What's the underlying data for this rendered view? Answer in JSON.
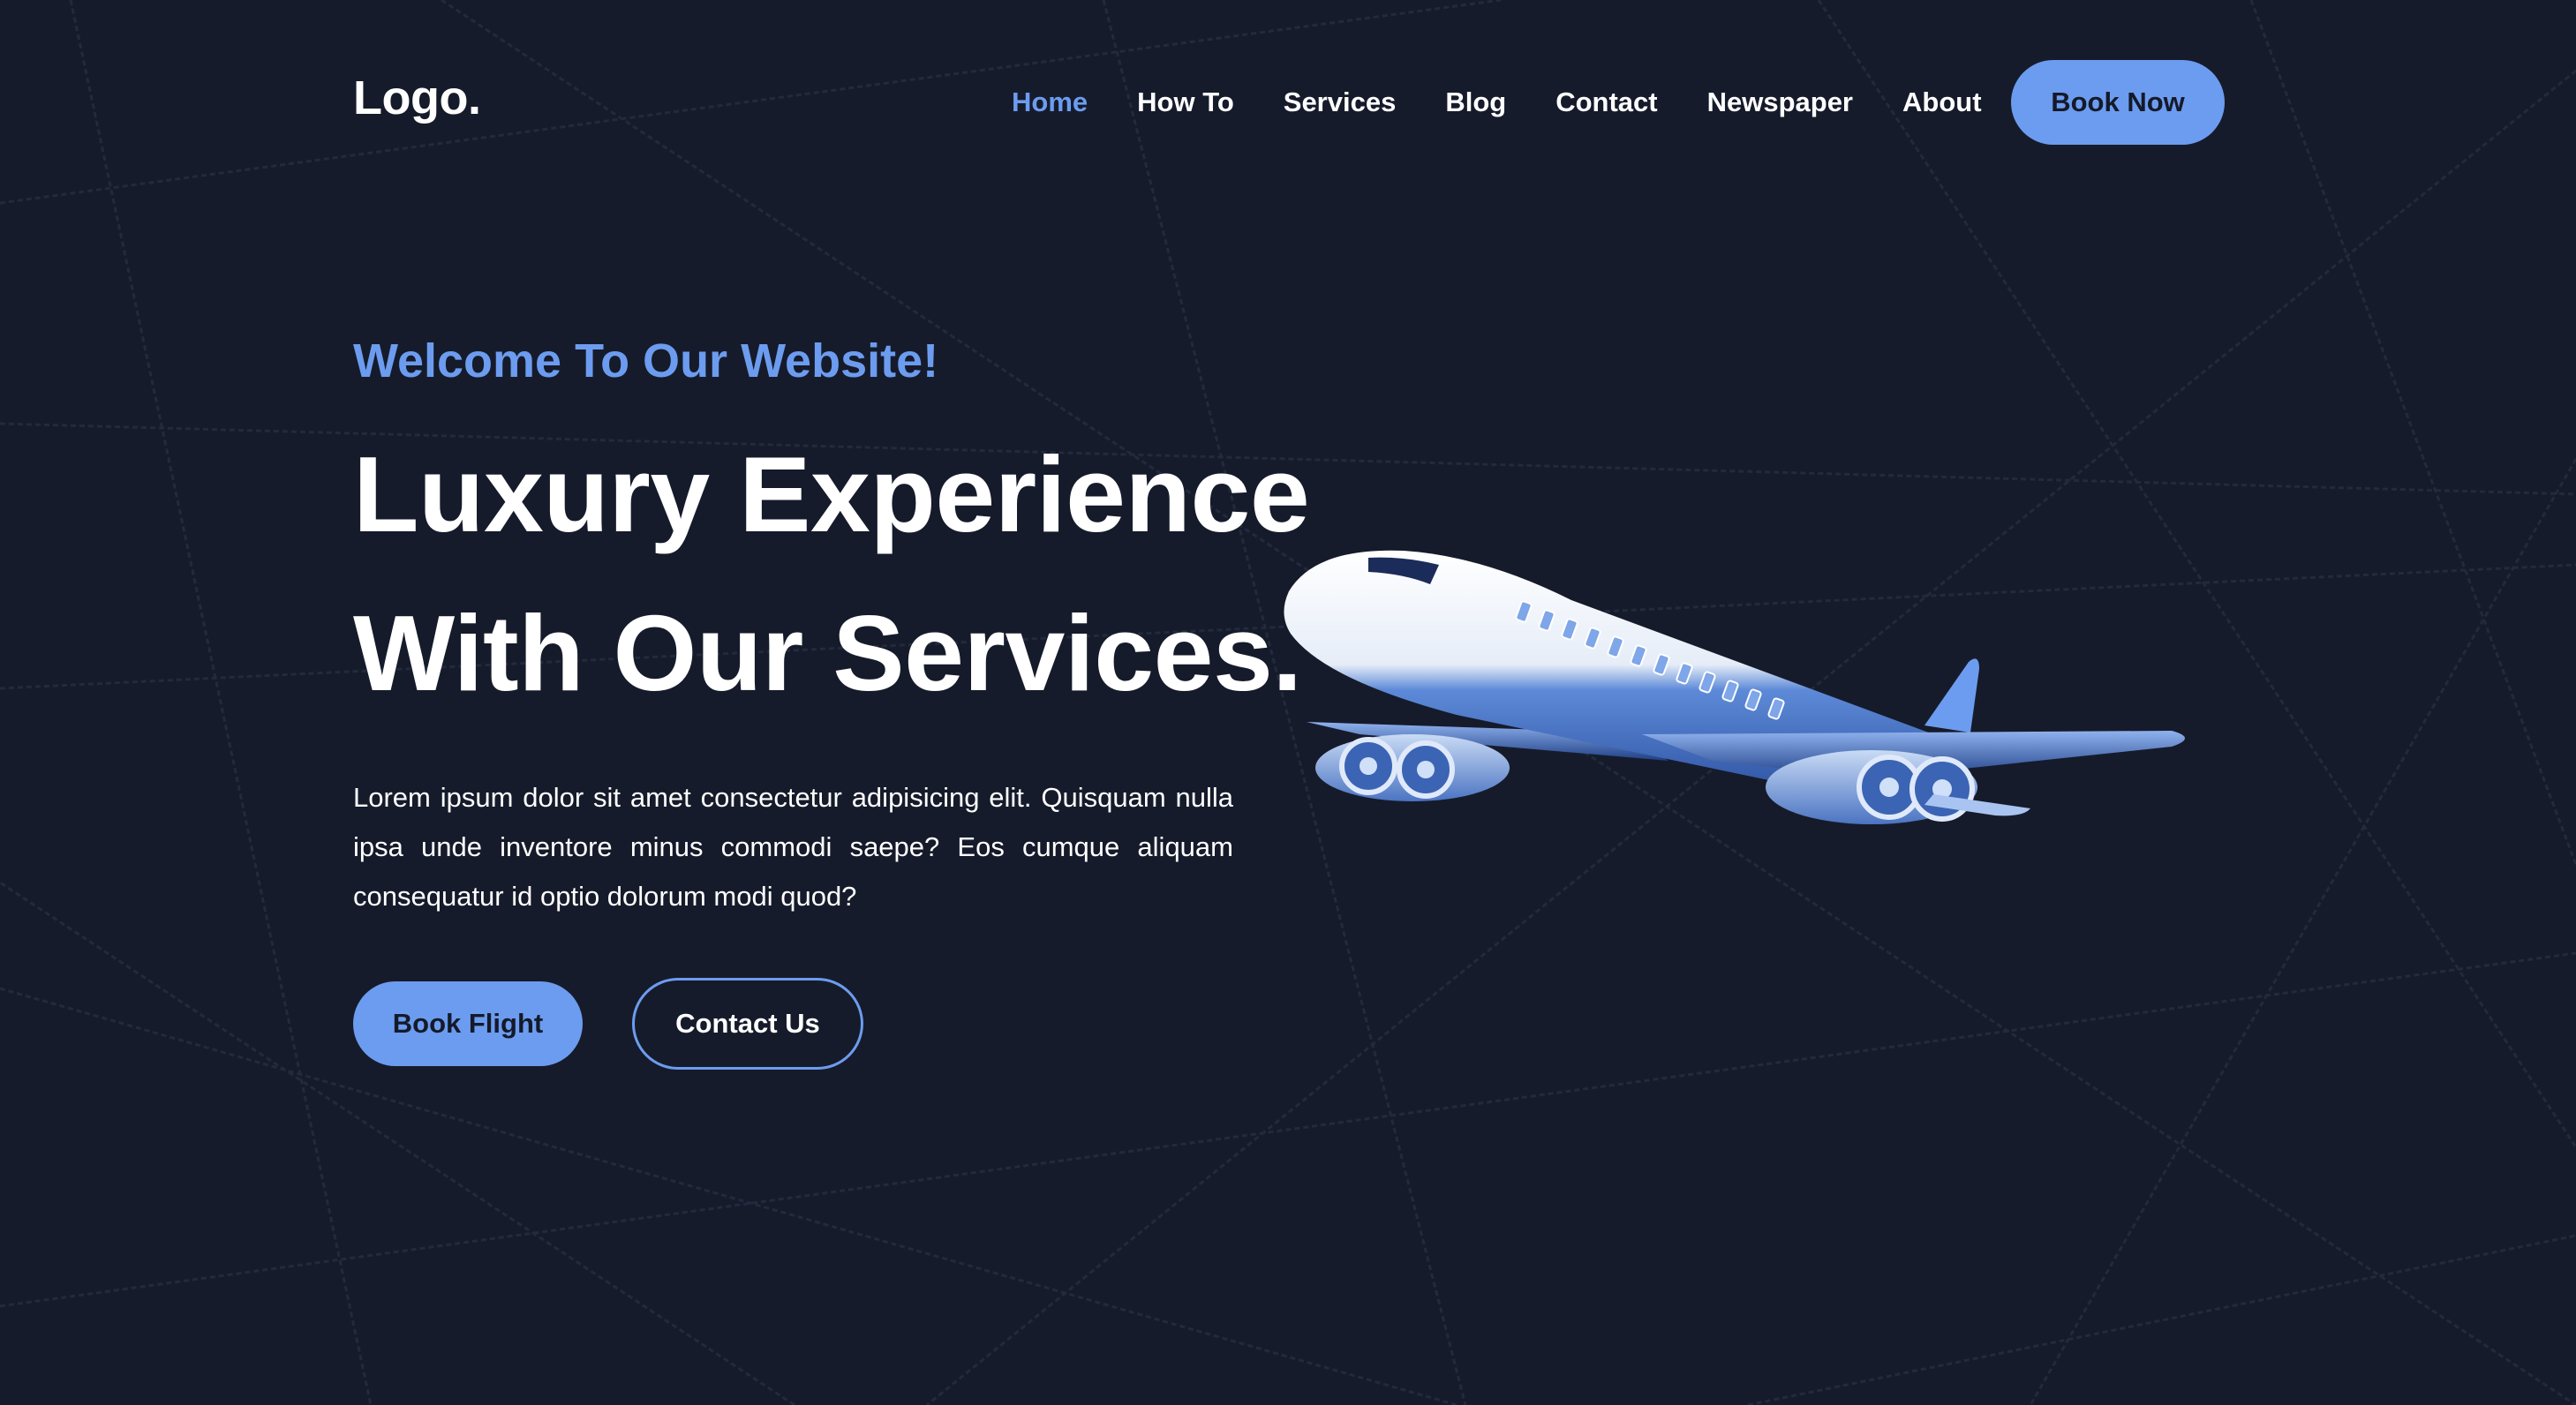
{
  "header": {
    "logo": "Logo.",
    "nav": [
      {
        "label": "Home",
        "active": true
      },
      {
        "label": "How To"
      },
      {
        "label": "Services"
      },
      {
        "label": "Blog"
      },
      {
        "label": "Contact"
      },
      {
        "label": "Newspaper"
      },
      {
        "label": "About"
      }
    ],
    "cta_label": "Book Now"
  },
  "hero": {
    "welcome": "Welcome To Our Website!",
    "headline_line1": "Luxury Experience",
    "headline_line2": "With Our Services.",
    "description": "Lorem ipsum dolor sit amet consectetur adipisicing elit. Quisquam nulla ipsa unde inventore minus commodi saepe? Eos cumque aliquam consequatur id optio dolorum modi quod?",
    "primary_button": "Book Flight",
    "secondary_button": "Contact Us"
  },
  "illustration": {
    "icon": "airplane-illustration"
  },
  "colors": {
    "background": "#161b2b",
    "accent": "#6c9cef",
    "text": "#ffffff",
    "button_text": "#141a2a"
  }
}
